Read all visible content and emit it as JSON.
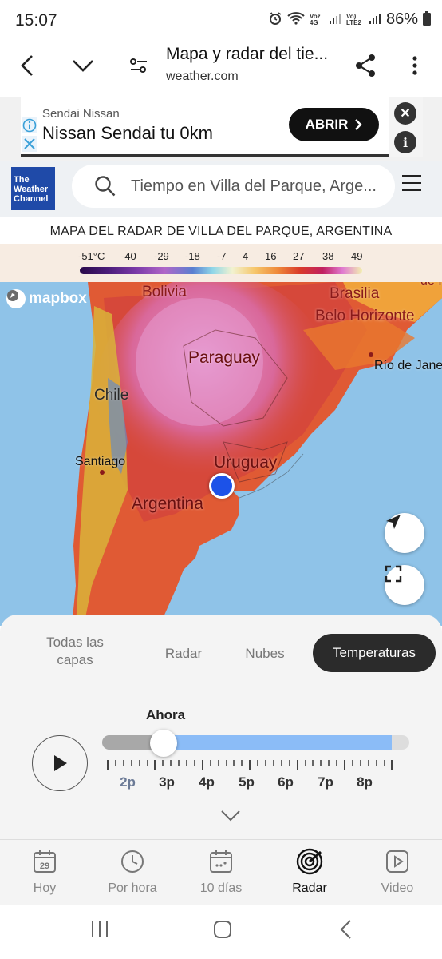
{
  "status_bar": {
    "time": "15:07",
    "network_label": "Voz 4G",
    "network_label2": "Vo) LTE2",
    "battery": "86%"
  },
  "browser": {
    "title": "Mapa y radar del tie...",
    "url": "weather.com"
  },
  "ad": {
    "advertiser": "Sendai Nissan",
    "headline": "Nissan Sendai tu 0km",
    "cta": "ABRIR"
  },
  "site_header": {
    "logo_text": "The Weather Channel",
    "search_placeholder": "Tiempo en Villa del Parque, Arge..."
  },
  "map": {
    "title": "MAPA DEL RADAR DE VILLA DEL PARQUE, ARGENTINA",
    "legend_ticks": [
      "-51°C",
      "-40",
      "-29",
      "-18",
      "-7",
      "4",
      "16",
      "27",
      "38",
      "49"
    ],
    "attribution": "mapbox",
    "labels": {
      "bolivia": "Bolivia",
      "brasilia": "Brasilia",
      "belo_horizonte": "Belo Horizonte",
      "paraguay": "Paraguay",
      "rio": "Río de Jane",
      "chile": "Chile",
      "santiago": "Santiago",
      "uruguay": "Uruguay",
      "argentina": "Argentina",
      "top_right": "de I"
    }
  },
  "layers": {
    "tabs": [
      {
        "label": "Todas las capas"
      },
      {
        "label": "Radar"
      },
      {
        "label": "Nubes"
      },
      {
        "label": "Temperaturas"
      }
    ],
    "active_tab": "Temperaturas"
  },
  "timeline": {
    "now_label": "Ahora",
    "hours": [
      "2p",
      "3p",
      "4p",
      "5p",
      "6p",
      "7p",
      "8p"
    ],
    "selected_hour": "3p"
  },
  "bottom_nav": {
    "items": [
      {
        "label": "Hoy",
        "icon": "calendar-day-icon",
        "day": "29"
      },
      {
        "label": "Por hora",
        "icon": "clock-icon"
      },
      {
        "label": "10 días",
        "icon": "calendar-icon"
      },
      {
        "label": "Radar",
        "icon": "radar-icon"
      },
      {
        "label": "Video",
        "icon": "video-icon"
      }
    ],
    "active": "Radar"
  },
  "colors": {
    "accent_dark": "#2b2b2b",
    "timeline_future": "#8bbcf7",
    "location_dot": "#1c52e8",
    "twc_blue": "#1f4aa8"
  }
}
